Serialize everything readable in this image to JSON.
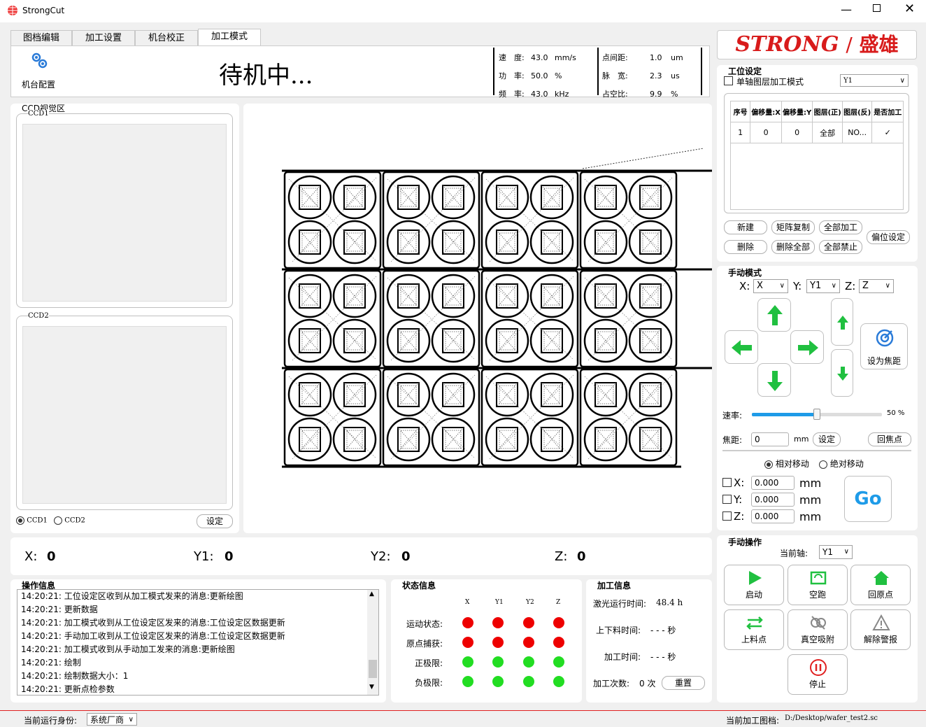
{
  "window": {
    "title": "StrongCut"
  },
  "tabs": [
    "图档编辑",
    "加工设置",
    "机台校正",
    "加工模式"
  ],
  "toolbar": {
    "machine_config": "机台配置"
  },
  "status": {
    "main": "待机中..."
  },
  "params": {
    "speed_label": "速　度:",
    "speed_value": "43.0",
    "speed_unit": "mm/s",
    "power_label": "功　率:",
    "power_value": "50.0",
    "power_unit": "%",
    "freq_label": "频　率:",
    "freq_value": "43.0",
    "freq_unit": "kHz",
    "dot_dist_label": "点间距:",
    "dot_dist_value": "1.0",
    "dot_dist_unit": "um",
    "pulse_label": "脉　宽:",
    "pulse_value": "2.3",
    "pulse_unit": "us",
    "duty_label": "占空比:",
    "duty_value": "9.9",
    "duty_unit": "%"
  },
  "ccd": {
    "title": "CCD视觉区",
    "ccd1": "CCD1",
    "ccd2": "CCD2",
    "radio1": "CCD1",
    "radio2": "CCD2",
    "settings": "设定"
  },
  "logo": {
    "text_en": "STRONG",
    "sep": "/",
    "text_cn": "盛雄"
  },
  "station": {
    "title": "工位设定",
    "single_axis": "单轴图层加工模式",
    "axis_select": "Y1",
    "columns": [
      "序号",
      "偏移量:X",
      "偏移量:Y",
      "图层(正)",
      "图层(反)",
      "是否加工"
    ],
    "rows": [
      [
        "1",
        "0",
        "0",
        "全部",
        "NO...",
        "✓"
      ]
    ],
    "buttons": {
      "new": "新建",
      "matrix": "矩阵复制",
      "all_process": "全部加工",
      "offset": "偏位设定",
      "delete": "删除",
      "delete_all": "删除全部",
      "all_disable": "全部禁止"
    }
  },
  "manual_mode": {
    "title": "手动模式",
    "x_label": "X:",
    "x_sel": "X",
    "y_label": "Y:",
    "y_sel": "Y1",
    "z_label": "Z:",
    "z_sel": "Z",
    "set_focus": "设为焦距",
    "rate_label": "速率:",
    "rate_value": 50,
    "rate_text": "50 %",
    "focus_label": "焦距:",
    "focus_value": "0",
    "focus_unit": "mm",
    "focus_set": "设定",
    "origin": "回焦点",
    "relative": "相对移动",
    "absolute": "绝对移动",
    "mx_label": "X:",
    "mx_value": "0.000",
    "my_label": "Y:",
    "my_value": "0.000",
    "mz_label": "Z:",
    "mz_value": "0.000",
    "unit": "mm",
    "go": "Go"
  },
  "coords": {
    "x_label": "X:",
    "x": "0",
    "y1_label": "Y1:",
    "y1": "0",
    "y2_label": "Y2:",
    "y2": "0",
    "z_label": "Z:",
    "z": "0"
  },
  "oplog": {
    "title": "操作信息",
    "lines": [
      "14:20:21: 工位设定区收到从加工模式发来的消息:更新绘图",
      "14:20:21: 更新数据",
      "14:20:21: 加工模式收到从工位设定区发来的消息:工位设定区数据更新",
      "14:20:21: 手动加工收到从工位设定区发来的消息:工位设定区数据更新",
      "14:20:21: 加工模式收到从手动加工发来的消息:更新绘图",
      "14:20:21: 绘制",
      "14:20:21: 绘制数据大小：1",
      "14:20:21: 更新点检参数"
    ]
  },
  "state": {
    "title": "状态信息",
    "axes": [
      "X",
      "Y1",
      "Y2",
      "Z"
    ],
    "rows": [
      {
        "label": "运动状态:",
        "colors": [
          "red",
          "red",
          "red",
          "red"
        ]
      },
      {
        "label": "原点捕获:",
        "colors": [
          "red",
          "red",
          "red",
          "red"
        ]
      },
      {
        "label": "正极限:",
        "colors": [
          "green",
          "green",
          "green",
          "green"
        ]
      },
      {
        "label": "负极限:",
        "colors": [
          "green",
          "green",
          "green",
          "green"
        ]
      }
    ]
  },
  "process": {
    "title": "加工信息",
    "laser_time_label": "激光运行时间:",
    "laser_time": "48.4 h",
    "load_time_label": "上下料时间:",
    "load_time": "- - - 秒",
    "proc_time_label": "加工时间:",
    "proc_time": "- - - 秒",
    "count_label": "加工次数:",
    "count": "0 次",
    "reset": "重置"
  },
  "manual_op": {
    "title": "手动操作",
    "axis_label": "当前轴:",
    "axis_value": "Y1",
    "start": "启动",
    "dry_run": "空跑",
    "home": "回原点",
    "load": "上料点",
    "vacuum": "真空吸附",
    "alarm": "解除警报",
    "stop": "停止"
  },
  "statusbar": {
    "role_label": "当前运行身份:",
    "role": "系统厂商",
    "file_label": "当前加工图档:",
    "file": "D:/Desktop/wafer_test2.sc"
  }
}
